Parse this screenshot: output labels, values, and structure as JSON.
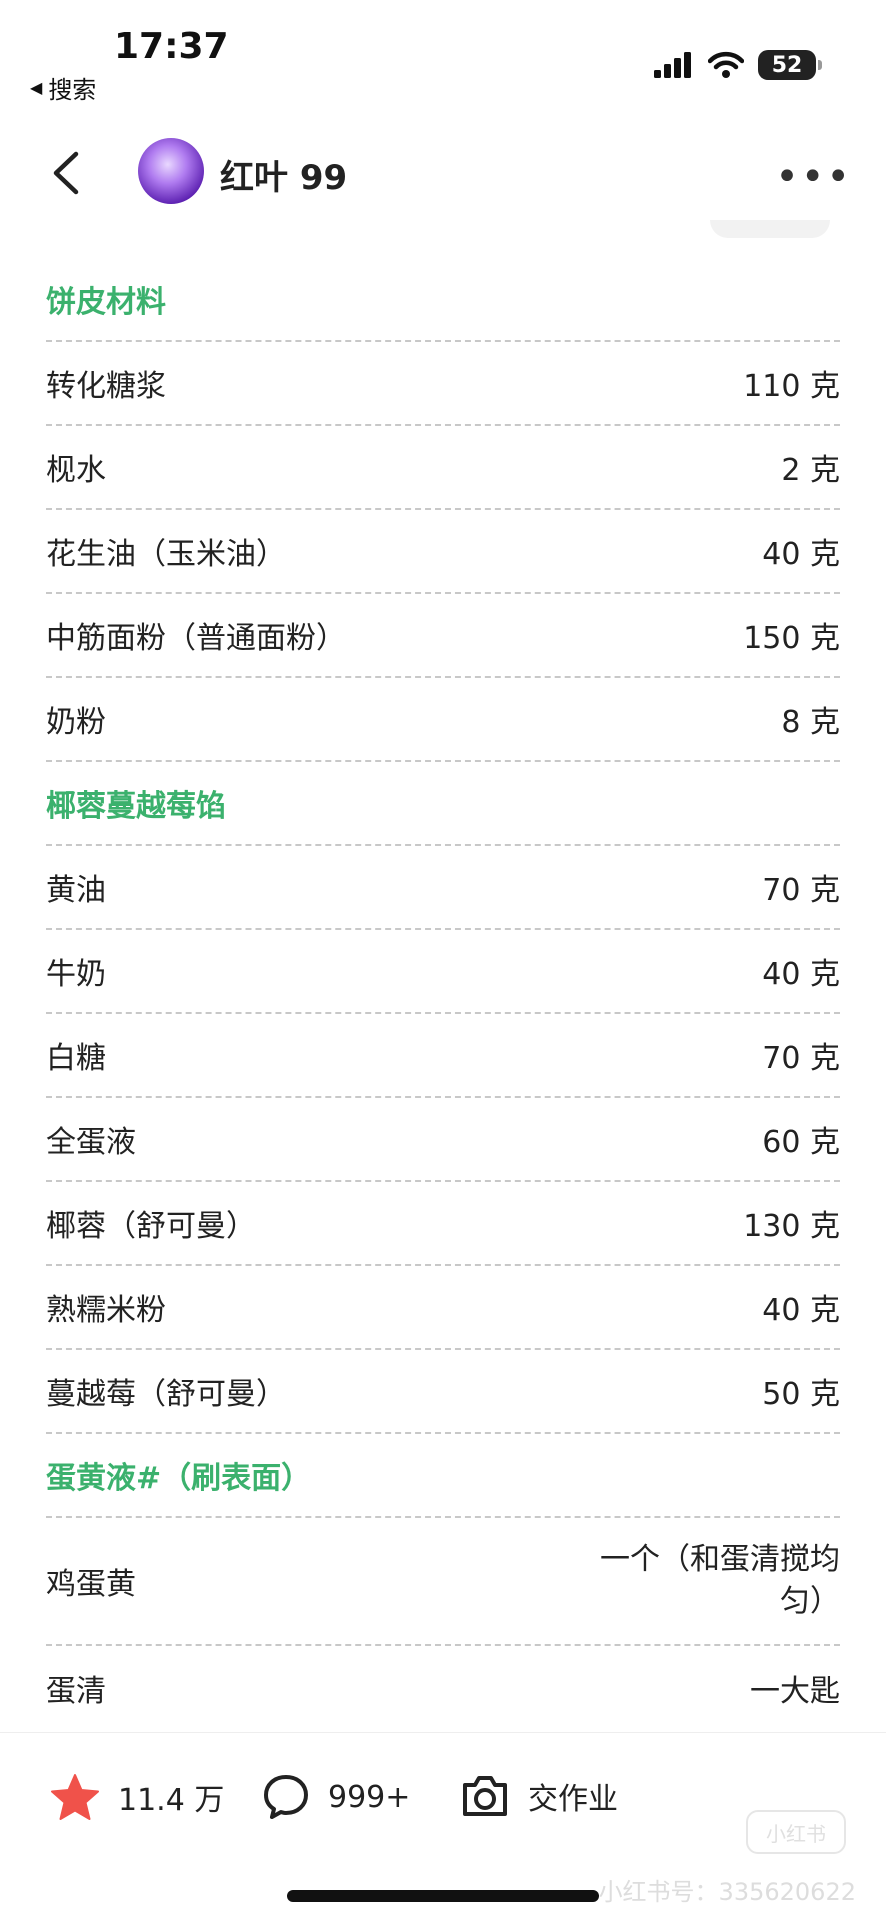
{
  "status_bar": {
    "time": "17:37",
    "back_app": "搜索",
    "battery": "52"
  },
  "header": {
    "author": "红叶 99"
  },
  "ingredients": [
    {
      "type": "section",
      "label": "饼皮材料",
      "qty": ""
    },
    {
      "type": "item",
      "label": "转化糖浆",
      "qty": "110 克"
    },
    {
      "type": "item",
      "label": "枧水",
      "qty": "2 克"
    },
    {
      "type": "item",
      "label": "花生油（玉米油）",
      "qty": "40 克"
    },
    {
      "type": "item",
      "label": "中筋面粉（普通面粉）",
      "qty": "150 克"
    },
    {
      "type": "item",
      "label": "奶粉",
      "qty": "8 克"
    },
    {
      "type": "section",
      "label": "椰蓉蔓越莓馅",
      "qty": ""
    },
    {
      "type": "item",
      "label": "黄油",
      "qty": "70 克"
    },
    {
      "type": "item",
      "label": "牛奶",
      "qty": "40 克"
    },
    {
      "type": "item",
      "label": "白糖",
      "qty": "70 克"
    },
    {
      "type": "item",
      "label": "全蛋液",
      "qty": "60 克"
    },
    {
      "type": "item",
      "label": "椰蓉（舒可曼）",
      "qty": "130 克"
    },
    {
      "type": "item",
      "label": "熟糯米粉",
      "qty": "40 克"
    },
    {
      "type": "item",
      "label": "蔓越莓（舒可曼）",
      "qty": "50 克"
    },
    {
      "type": "section",
      "label": "蛋黄液#（刷表面）",
      "qty": ""
    },
    {
      "type": "item",
      "label": "鸡蛋黄",
      "qty": "一个（和蛋清搅均匀）"
    },
    {
      "type": "item",
      "label": "蛋清",
      "qty": "一大匙"
    }
  ],
  "bottom_bar": {
    "likes": "11.4 万",
    "comments": "999+",
    "homework": "交作业"
  },
  "watermark": {
    "logo": "小红书",
    "id_text": "小红书号：335620622"
  },
  "colors": {
    "section_green": "#3bb16d",
    "like_red": "#f0524a"
  }
}
